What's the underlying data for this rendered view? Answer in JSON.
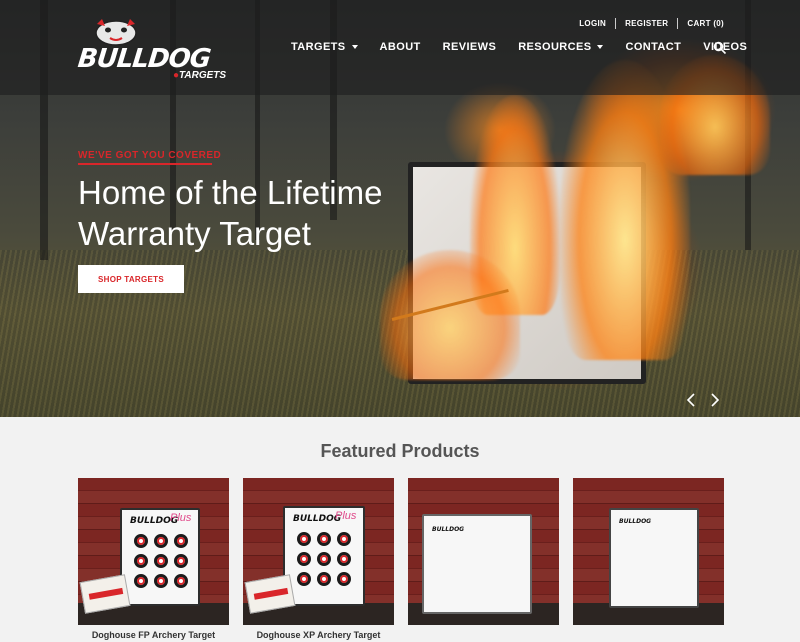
{
  "brand": {
    "name": "BULLDOG",
    "sub": "TARGETS",
    "accent_color": "#d9262a"
  },
  "utility_nav": {
    "login": "LOGIN",
    "register": "REGISTER",
    "cart": "CART (0)"
  },
  "main_nav": {
    "items": [
      {
        "label": "TARGETS",
        "has_dropdown": true
      },
      {
        "label": "ABOUT",
        "has_dropdown": false
      },
      {
        "label": "REVIEWS",
        "has_dropdown": false
      },
      {
        "label": "RESOURCES",
        "has_dropdown": true
      },
      {
        "label": "CONTACT",
        "has_dropdown": false
      },
      {
        "label": "VIDEOS",
        "has_dropdown": false
      }
    ],
    "search_icon": "search-icon"
  },
  "hero": {
    "tagline": "WE'VE GOT YOU COVERED",
    "title": "Home of the Lifetime Warranty Target",
    "cta": "SHOP TARGETS",
    "prev_icon": "chevron-left-icon",
    "next_icon": "chevron-right-icon"
  },
  "featured": {
    "heading": "Featured Products",
    "products": [
      {
        "name": "Doghouse FP Archery Target"
      },
      {
        "name": "Doghouse XP Archery Target"
      },
      {
        "name": ""
      },
      {
        "name": ""
      }
    ]
  }
}
